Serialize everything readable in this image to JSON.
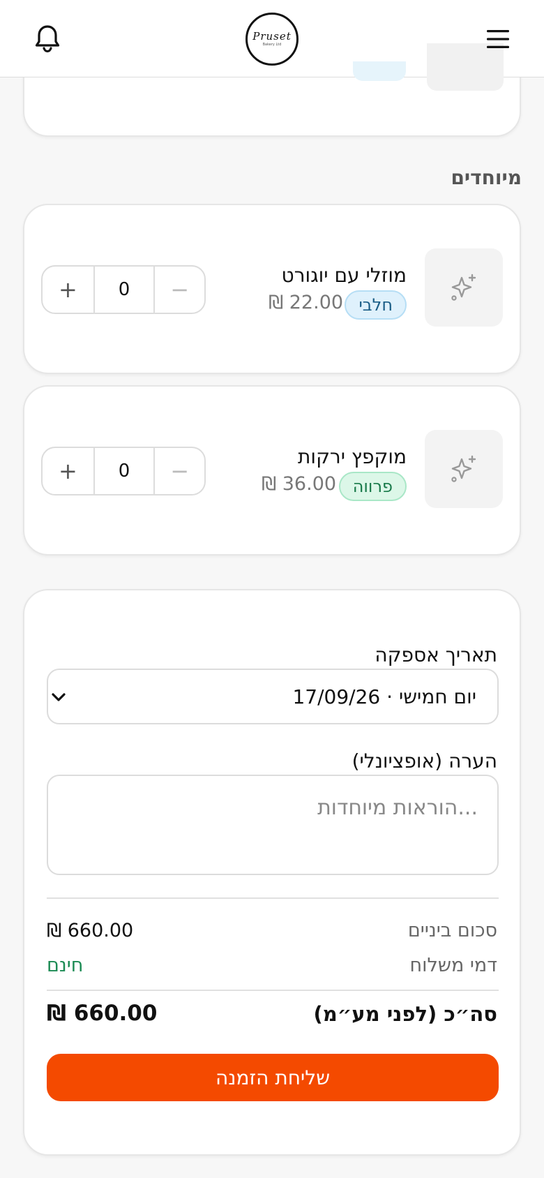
{
  "header": {
    "logo_text": "Pruset",
    "logo_sub": "Bakery Ltd"
  },
  "section": {
    "title": "מיוחדים"
  },
  "products": [
    {
      "name": "מוזלי עם יוגורט",
      "tag": "חלבי",
      "price": "₪ 22.00",
      "quantity": "0",
      "plus": "+",
      "minus": "−"
    },
    {
      "name": "מוקפץ ירקות",
      "tag": "פרווה",
      "price": "₪ 36.00",
      "quantity": "0",
      "plus": "+",
      "minus": "−"
    }
  ],
  "order": {
    "date_label": "תאריך אספקה",
    "date_value": "יום חמישי · 17/09/26",
    "note_label": "הערה (אופציונלי)",
    "note_placeholder": "הוראות מיוחדות...",
    "subtotal_label": "סכום ביניים",
    "subtotal_value": "₪ 660.00",
    "shipping_label": "דמי משלוח",
    "shipping_value": "חינם",
    "total_label": "סה״כ (לפני מע״מ)",
    "total_value": "₪ 660.00",
    "submit_label": "שליחת הזמנה"
  },
  "colors": {
    "accent": "#f44a00",
    "free": "#1c8b54",
    "dairy_tag": "#dff1fc",
    "parve_tag": "#dcf7e8"
  }
}
